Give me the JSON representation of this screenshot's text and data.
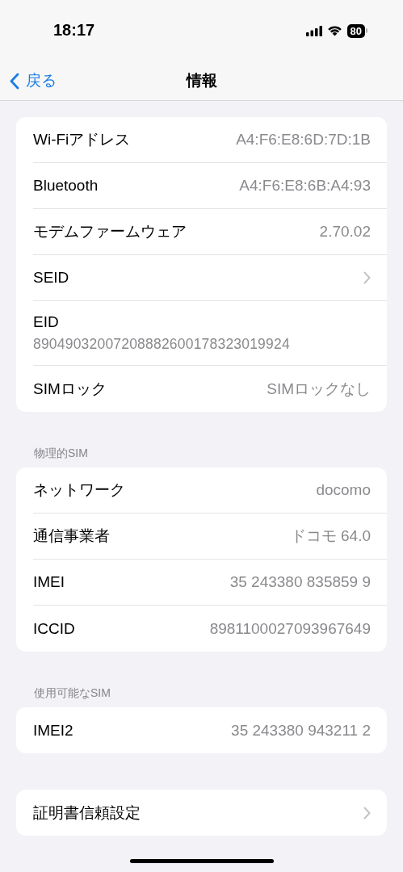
{
  "status_bar": {
    "time": "18:17",
    "battery": "80"
  },
  "nav": {
    "back": "戻る",
    "title": "情報"
  },
  "groups": [
    {
      "rows": [
        {
          "kind": "value",
          "label": "Wi-Fiアドレス",
          "value": "A4:F6:E8:6D:7D:1B"
        },
        {
          "kind": "value",
          "label": "Bluetooth",
          "value": "A4:F6:E8:6B:A4:93"
        },
        {
          "kind": "value",
          "label": "モデムファームウェア",
          "value": "2.70.02"
        },
        {
          "kind": "chevron",
          "label": "SEID"
        },
        {
          "kind": "stacked",
          "label": "EID",
          "value": "89049032007208882600178323019924"
        },
        {
          "kind": "value",
          "label": "SIMロック",
          "value": "SIMロックなし"
        }
      ]
    },
    {
      "header": "物理的SIM",
      "rows": [
        {
          "kind": "value",
          "label": "ネットワーク",
          "value": "docomo"
        },
        {
          "kind": "value",
          "label": "通信事業者",
          "value": "ドコモ 64.0"
        },
        {
          "kind": "value",
          "label": "IMEI",
          "value": "35 243380 835859 9"
        },
        {
          "kind": "value",
          "label": "ICCID",
          "value": "8981100027093967649"
        }
      ]
    },
    {
      "header": "使用可能なSIM",
      "rows": [
        {
          "kind": "value",
          "label": "IMEI2",
          "value": "35 243380 943211 2"
        }
      ]
    },
    {
      "rows": [
        {
          "kind": "chevron",
          "label": "証明書信頼設定"
        }
      ]
    }
  ]
}
